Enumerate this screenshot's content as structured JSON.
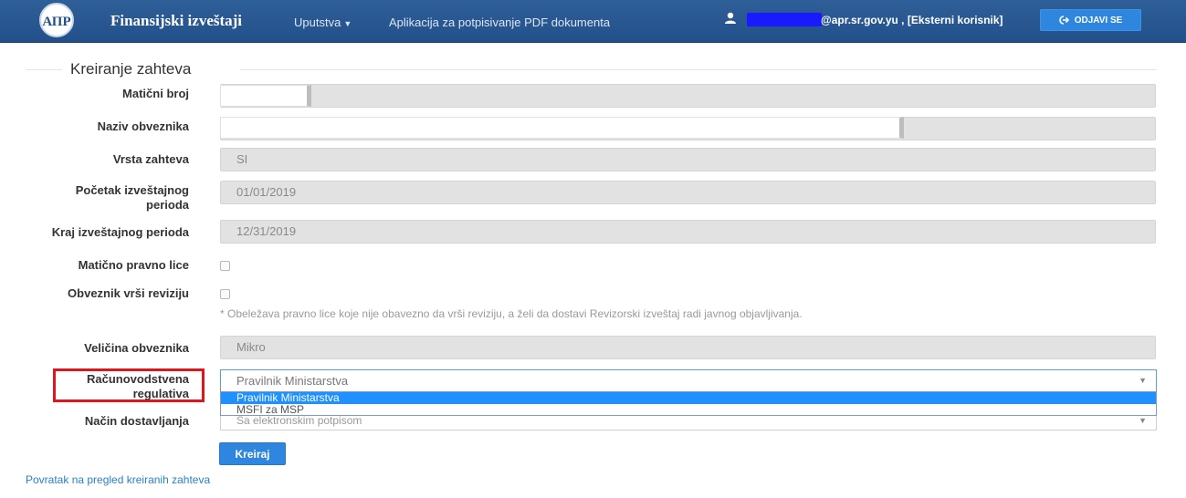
{
  "navbar": {
    "logo_text": "АПР",
    "brand": "Finansijski izveštaji",
    "menu_uputstva": "Uputstva",
    "menu_app": "Aplikacija za potpisivanje PDF dokumenta",
    "user_text": "@apr.sr.gov.yu , [Eksterni korisnik]",
    "logout_label": "ODJAVI SE"
  },
  "form": {
    "title": "Kreiranje zahteva",
    "maticni_broj_label": "Matični broj",
    "naziv_label": "Naziv obveznika",
    "vrsta_label": "Vrsta zahteva",
    "vrsta_value": "SI",
    "pocetak_label_1": "Početak izveštajnog",
    "pocetak_label_2": "perioda",
    "pocetak_value": "01/01/2019",
    "kraj_label": "Kraj izveštajnog perioda",
    "kraj_value": "12/31/2019",
    "maticno_pravno_lice_label": "Matično pravno lice",
    "revizija_label": "Obveznik vrši reviziju",
    "revizija_hint": "* Obeležava pravno lice koje nije obavezno da vrši reviziju, a želi da dostavi Revizorski izveštaj radi javnog objavljivanja.",
    "velicina_label": "Veličina obveznika",
    "velicina_value": "Mikro",
    "regulativa_label_1": "Računovodstvena",
    "regulativa_label_2": "regulativa",
    "regulativa_value": "Pravilnik Ministarstva",
    "regulativa_options": [
      "Pravilnik Ministarstva",
      "MSFI za MSP"
    ],
    "nacin_label": "Način dostavljanja",
    "nacin_value": "Sa elektronskim potpisom",
    "submit_label": "Kreiraj",
    "back_link": "Povratak na pregled kreiranih zahteva"
  },
  "colors": {
    "navbar": "#2a5894",
    "primary_button": "#2e86de",
    "highlight_box": "#e0161e",
    "selected_option": "#1e90ff"
  }
}
